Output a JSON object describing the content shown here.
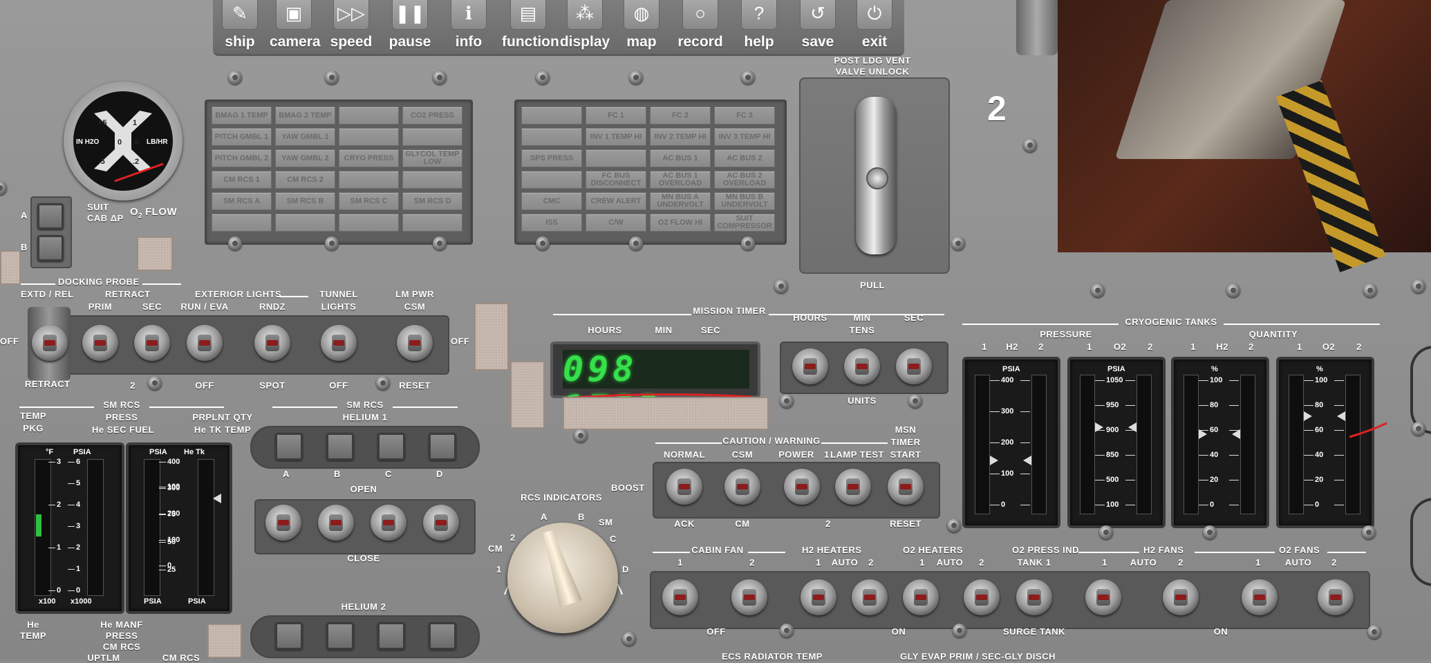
{
  "toolbar": {
    "items": [
      {
        "label": "ship",
        "icon": "wrench-icon"
      },
      {
        "label": "camera",
        "icon": "camera-icon"
      },
      {
        "label": "speed",
        "icon": "fast-forward-icon"
      },
      {
        "label": "pause",
        "icon": "pause-icon"
      },
      {
        "label": "info",
        "icon": "info-icon"
      },
      {
        "label": "function",
        "icon": "function-icon"
      },
      {
        "label": "display",
        "icon": "display-icon"
      },
      {
        "label": "map",
        "icon": "globe-icon"
      },
      {
        "label": "record",
        "icon": "record-icon"
      },
      {
        "label": "help",
        "icon": "help-icon"
      },
      {
        "label": "save",
        "icon": "save-icon"
      },
      {
        "label": "exit",
        "icon": "power-icon"
      }
    ],
    "glyphs": [
      "✎",
      "▣",
      "▷▷",
      "❚❚",
      "ℹ",
      "▤",
      "⁂",
      "◍",
      "○",
      "?",
      "↺",
      "⏻"
    ]
  },
  "o2flow": {
    "labels": [
      "+5",
      "1",
      "IN H2O",
      "0",
      ".6",
      "LB/HR",
      "-5",
      ".2"
    ],
    "suit": "SUIT",
    "cab": "CAB ΔP",
    "o2": "O",
    "o2sub": "2",
    "flow": "FLOW",
    "a": "A",
    "b": "B"
  },
  "caution_left": [
    "BMAG 1 TEMP",
    "BMAG 2 TEMP",
    "",
    "CO2 PRESS",
    "PITCH GMBL 1",
    "YAW GMBL 1",
    "",
    "",
    "PITCH GMBL 2",
    "YAW GMBL 2",
    "CRYO PRESS",
    "GLYCOL TEMP LOW",
    "CM RCS 1",
    "CM RCS 2",
    "",
    "",
    "SM RCS A",
    "SM RCS B",
    "SM RCS C",
    "SM RCS D",
    "",
    "",
    "",
    ""
  ],
  "caution_right": [
    "",
    "FC 1",
    "FC 2",
    "FC 3",
    "",
    "INV 1 TEMP HI",
    "INV 2 TEMP HI",
    "INV 3 TEMP HI",
    "SPS PRESS",
    "",
    "AC BUS 1",
    "AC BUS 2",
    "",
    "FC BUS DISCONNECT",
    "AC BUS 1 OVERLOAD",
    "AC BUS 2 OVERLOAD",
    "CMC",
    "CREW ALERT",
    "MN BUS A UNDERVOLT",
    "MN BUS B UNDERVOLT",
    "ISS",
    "C/W",
    "O2 FLOW HI",
    "SUIT COMPRESSOR"
  ],
  "vent": {
    "title1": "POST LDG VENT",
    "title2": "VALVE UNLOCK",
    "pull": "PULL"
  },
  "window_number": "2",
  "docking": {
    "docking_probe": "DOCKING PROBE",
    "extd_rel": "EXTD / REL",
    "retract_top": "RETRACT",
    "retract_bottom": "RETRACT",
    "prim": "PRIM",
    "sec": "SEC",
    "ext_lights": "EXTERIOR LIGHTS",
    "run_eva": "RUN / EVA",
    "rndz": "RNDZ",
    "tunnel1": "TUNNEL",
    "tunnel2": "LIGHTS",
    "lmpwr1": "LM PWR",
    "lmpwr2": "CSM",
    "off_left": "OFF",
    "off_right": "OFF",
    "two": "2",
    "off1": "OFF",
    "spot": "SPOT",
    "off2": "OFF",
    "reset": "RESET"
  },
  "mission_timer": {
    "title": "MISSION TIMER",
    "hours": "HOURS",
    "min": "MIN",
    "sec": "SEC",
    "display": "098 1723",
    "set_hours": "HOURS",
    "set_min": "MIN",
    "set_sec": "SEC",
    "tens": "TENS",
    "units": "UNITS"
  },
  "sm_rcs_left": {
    "sm_rcs": "SM RCS",
    "temp1": "TEMP",
    "temp2": "PKG",
    "press": "PRESS",
    "he_sec_fuel": "He SEC FUEL",
    "prplnt_qty": "PRPLNT QTY",
    "he_tk_temp": "He TK TEMP",
    "g1_unit": "°F",
    "g1_unit2": "PSIA",
    "g1_scale": [
      "3",
      "2",
      "1",
      "0"
    ],
    "g1_scale2": [
      "6",
      "5",
      "4",
      "3",
      "2",
      "1",
      "0"
    ],
    "x100": "x100",
    "x1000": "x1000",
    "g2_unit": "PSIA",
    "g2_unit2": "He Tk",
    "g2_scale": [
      "400",
      "300",
      "200",
      "100",
      "0"
    ],
    "g2_scale2": [
      "100",
      "75",
      "50",
      "25"
    ],
    "psia1": "PSIA",
    "psia2": "PSIA"
  },
  "helium": {
    "sm_rcs": "SM RCS",
    "helium1": "HELIUM 1",
    "cols": [
      "A",
      "B",
      "C",
      "D"
    ],
    "open": "OPEN",
    "close": "CLOSE",
    "helium2": "HELIUM 2"
  },
  "bottom_left": {
    "he1": "He",
    "he2": "TEMP",
    "he_manf": "He MANF",
    "press": "PRESS",
    "cm_rcs": "CM RCS",
    "uptlm": "UPTLM",
    "cm_rcs2": "CM RCS"
  },
  "rcs_indicators": {
    "title": "RCS INDICATORS",
    "positions": [
      "CM",
      "2",
      "1",
      "A",
      "B",
      "SM",
      "C",
      "D"
    ]
  },
  "caution_warning": {
    "title": "CAUTION / WARNING",
    "normal": "NORMAL",
    "boost": "BOOST",
    "csm": "CSM",
    "power": "POWER",
    "one": "1",
    "lamp_test": "LAMP TEST",
    "msn1": "MSN",
    "msn2": "TIMER",
    "msn3": "START",
    "ack": "ACK",
    "cm": "CM",
    "two": "2",
    "reset": "RESET"
  },
  "cryo": {
    "title": "CRYOGENIC TANKS",
    "pressure": "PRESSURE",
    "quantity": "QUANTITY",
    "subs": [
      "1",
      "H2",
      "2",
      "1",
      "O2",
      "2",
      "1",
      "H2",
      "2",
      "1",
      "O2",
      "2"
    ],
    "gauges": [
      {
        "unit": "PSIA",
        "scale": [
          "400",
          "300",
          "200",
          "100",
          "0"
        ],
        "level": 0.38
      },
      {
        "unit": "PSIA",
        "scale": [
          "1050",
          "950",
          "900",
          "850",
          "500",
          "100"
        ],
        "level": 0.62
      },
      {
        "unit": "%",
        "scale": [
          "100",
          "80",
          "60",
          "40",
          "20",
          "0"
        ],
        "level": 0.57
      },
      {
        "unit": "%",
        "scale": [
          "100",
          "80",
          "60",
          "40",
          "20",
          "0"
        ],
        "level": 0.7
      }
    ]
  },
  "bottom_row": {
    "cabin_fan": "CABIN FAN",
    "h2heaters": "H2 HEATERS",
    "o2heaters": "O2 HEATERS",
    "o2press_ind": "O2 PRESS IND",
    "h2fans": "H2 FANS",
    "o2fans": "O2 FANS",
    "one": "1",
    "two": "2",
    "auto": "AUTO",
    "tank1": "TANK 1",
    "off": "OFF",
    "on": "ON",
    "surge": "SURGE TANK",
    "ecs": "ECS RADIATOR TEMP",
    "gly": "GLY EVAP PRIM / SEC-GLY DISCH"
  },
  "colors": {
    "panel": "#8c8c8c",
    "display_green": "#35e04a",
    "lamp": "#9b9b9b",
    "switch_red": "#8d1c1c"
  }
}
